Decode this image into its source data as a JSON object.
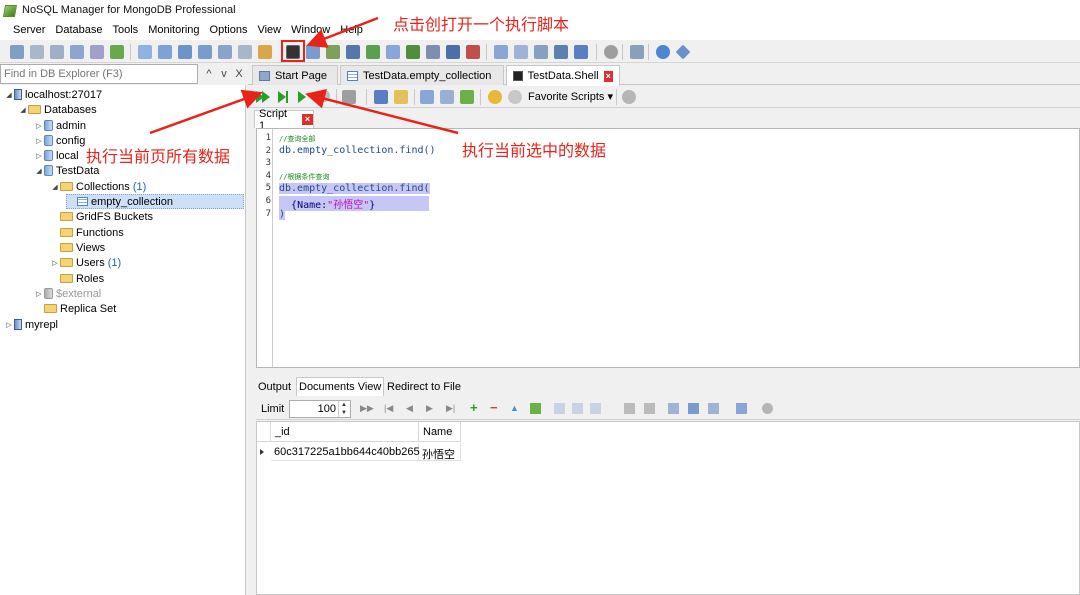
{
  "window": {
    "title": "NoSQL Manager for MongoDB Professional"
  },
  "menu": [
    "Server",
    "Database",
    "Tools",
    "Monitoring",
    "Options",
    "View",
    "Window",
    "Help"
  ],
  "find": {
    "placeholder": "Find in DB Explorer (F3)",
    "up": "^",
    "down": "v",
    "close": "X"
  },
  "tree": {
    "server": "localhost:27017",
    "databases_label": "Databases",
    "dbs": [
      "admin",
      "config",
      "local"
    ],
    "testdata": "TestData",
    "collections_label": "Collections",
    "collections_count": "(1)",
    "collection": "empty_collection",
    "gridfs": "GridFS Buckets",
    "functions": "Functions",
    "views": "Views",
    "users_label": "Users",
    "users_count": "(1)",
    "roles": "Roles",
    "external": "$external",
    "replica": "Replica Set",
    "myrepl": "myrepl"
  },
  "tabs": [
    {
      "label": "Start Page",
      "icon": "start-page-icon"
    },
    {
      "label": "TestData.empty_collection",
      "icon": "collection-icon"
    },
    {
      "label": "TestData.Shell",
      "icon": "shell-icon",
      "active": true
    }
  ],
  "script_toolbar": {
    "favorite_label": "Favorite Scripts"
  },
  "script_tab": {
    "label": "Script 1"
  },
  "editor": {
    "lines": [
      "1",
      "2",
      "3",
      "4",
      "5",
      "6",
      "7"
    ],
    "code": {
      "l1": "//查询全部",
      "l2": "db.empty_collection.find()",
      "l4": "//根据条件查询",
      "l5": "db.empty_collection.find(",
      "l6_key": "{Name:",
      "l6_val": "\"孙悟空\"",
      "l6_end": "}",
      "l7": ")"
    }
  },
  "bottom_tabs": [
    "Output",
    "Documents View",
    "Redirect to File"
  ],
  "bottom_toolbar": {
    "limit_label": "Limit",
    "limit_value": "100"
  },
  "grid": {
    "columns": [
      "_id",
      "Name"
    ],
    "rows": [
      [
        "60c317225a1bb644c40bb265",
        "孙悟空"
      ]
    ]
  },
  "annotations": {
    "open_script": "点击创打开一个执行脚本",
    "run_all": "执行当前页所有数据",
    "run_selected": "执行当前选中的数据"
  },
  "colors": {
    "annotation": "#e8231b",
    "selection": "#c7c7f5",
    "run_green": "#2a9e2a"
  }
}
